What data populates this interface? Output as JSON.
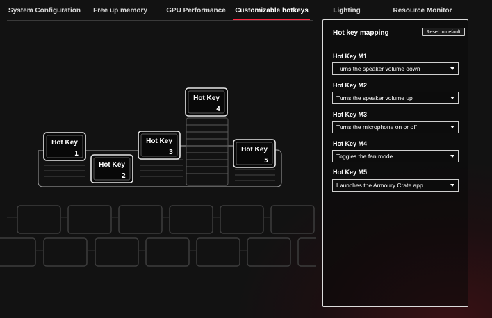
{
  "tabs": [
    {
      "label": "System Configuration"
    },
    {
      "label": "Free up memory"
    },
    {
      "label": "GPU Performance"
    },
    {
      "label": "Customizable hotkeys",
      "active": true
    },
    {
      "label": "Lighting"
    },
    {
      "label": "Resource Monitor"
    }
  ],
  "keyboard": {
    "keys": [
      {
        "label": "Hot Key",
        "number": "1"
      },
      {
        "label": "Hot Key",
        "number": "2"
      },
      {
        "label": "Hot Key",
        "number": "3"
      },
      {
        "label": "Hot Key",
        "number": "4"
      },
      {
        "label": "Hot Key",
        "number": "5"
      }
    ]
  },
  "panel": {
    "title": "Hot key mapping",
    "reset_label": "Reset to default",
    "mappings": [
      {
        "label": "Hot Key M1",
        "value": "Turns the speaker volume down"
      },
      {
        "label": "Hot Key M2",
        "value": "Turns the speaker volume up"
      },
      {
        "label": "Hot Key M3",
        "value": "Turns the microphone on or off"
      },
      {
        "label": "Hot Key M4",
        "value": "Toggles the fan mode"
      },
      {
        "label": "Hot Key M5",
        "value": "Launches the Armoury Crate app"
      }
    ]
  },
  "colors": {
    "accent": "#ff2943",
    "background": "#121212",
    "panel_border": "#dcdcdc"
  },
  "icons": [
    "caret-down-icon"
  ]
}
